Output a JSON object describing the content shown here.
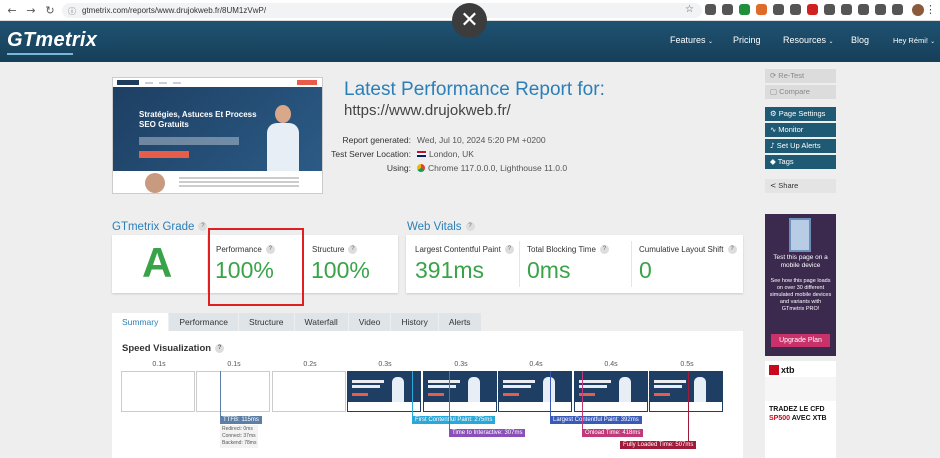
{
  "browser": {
    "url": "gtmetrix.com/reports/www.drujokweb.fr/8UM1zVwP/",
    "nav_back": "←",
    "nav_forward": "→",
    "nav_reload": "↻",
    "nav_home": "⌂",
    "close_overlay": "✕"
  },
  "header": {
    "logo": "GTmetrix",
    "nav": [
      "Features",
      "Pricing",
      "Resources",
      "Blog",
      "Hey Rémi!"
    ]
  },
  "thumbnail": {
    "title": "Stratégies, Astuces Et Process SEO Gratuits"
  },
  "report": {
    "title": "Latest Performance Report for:",
    "url": "https://www.drujokweb.fr/",
    "generated_label": "Report generated:",
    "generated_value": "Wed, Jul 10, 2024 5:20 PM +0200",
    "location_label": "Test Server Location:",
    "location_value": "London, UK",
    "using_label": "Using:",
    "using_value": "Chrome 117.0.0.0, Lighthouse 11.0.0"
  },
  "grade": {
    "heading": "GTmetrix Grade",
    "letter": "A",
    "performance_label": "Performance",
    "performance_value": "100%",
    "structure_label": "Structure",
    "structure_value": "100%"
  },
  "vitals": {
    "heading": "Web Vitals",
    "lcp_label": "Largest Contentful Paint",
    "lcp_value": "391ms",
    "tbt_label": "Total Blocking Time",
    "tbt_value": "0ms",
    "cls_label": "Cumulative Layout Shift",
    "cls_value": "0"
  },
  "tabs": [
    "Summary",
    "Performance",
    "Structure",
    "Waterfall",
    "Video",
    "History",
    "Alerts"
  ],
  "speed": {
    "heading": "Speed Visualization",
    "times": [
      "0.1s",
      "0.1s",
      "0.2s",
      "0.3s",
      "0.3s",
      "0.4s",
      "0.4s",
      "0.5s"
    ],
    "ttfb": "TTFB: 115ms",
    "ttfb_details": [
      "Redirect: 0ms",
      "Connect: 37ms",
      "Backend: 78ms"
    ],
    "fcp": "First Contentful Paint: 275ms",
    "tti": "Time to Interactive: 307ms",
    "lcp": "Largest Contentful Paint: 392ms",
    "onload": "Onload Time: 418ms",
    "fully_loaded": "Fully Loaded Time: 507ms"
  },
  "sidebar": {
    "retest": "Re-Test",
    "compare": "Compare",
    "page_settings": "Page Settings",
    "monitor": "Monitor",
    "alerts": "Set Up Alerts",
    "tags": "Tags",
    "share": "Share"
  },
  "promo": {
    "headline": "Test this page on a mobile device",
    "body": "See how this page loads on over 30 different simulated mobile devices and variants with GTmetrix PRO!",
    "button": "Upgrade Plan"
  },
  "ad": {
    "brand": "xtb",
    "line1": "TRADEZ LE CFD",
    "line2": "SP500",
    "line2b": "AVEC XTB"
  },
  "colors": {
    "accent": "#2b7fb8",
    "grade_green": "#3aa349",
    "header_bg": "#1b4a66",
    "highlight_red": "#e02020"
  }
}
